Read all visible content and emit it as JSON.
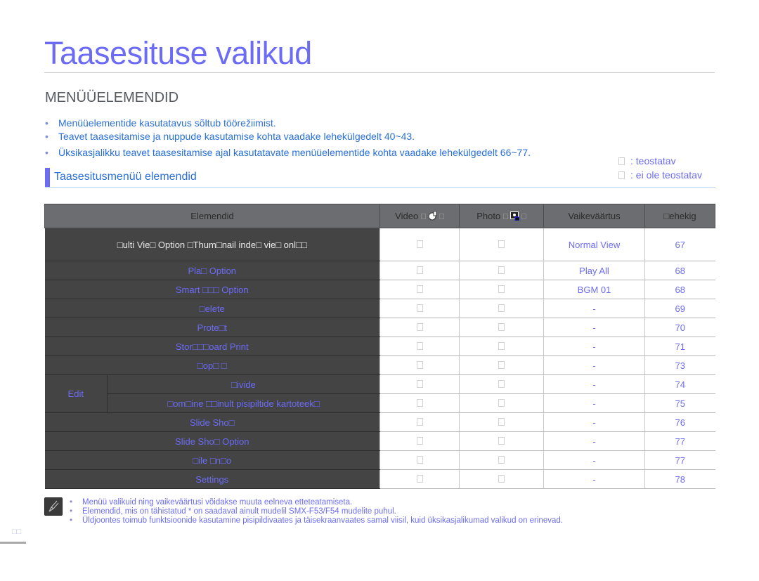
{
  "page": {
    "title": "Taasesituse valikud",
    "section_heading": "MENÜÜELEMENDID",
    "bullets": [
      "Menüüelementide kasutatavus sõltub töörežiimist.",
      "Teavet taasesitamise ja nuppude kasutamise kohta vaadake lehekülgedelt 40~43.",
      "Üksikasjalikku teavet taasesitamise ajal kasutatavate menüüelementide kohta vaadake lehekülgedelt 66~77."
    ],
    "legend": [
      {
        "icon": "available-box-icon",
        "label": ": teostatav"
      },
      {
        "icon": "unavailable-box-icon",
        "label": ": ei ole teostatav"
      }
    ],
    "subsection_heading": "Taasesitusmenüü elemendid",
    "page_number": "□□"
  },
  "table": {
    "headers": {
      "items": "Elemendid",
      "video": "Video",
      "photo": "Photo",
      "default": "Vaikeväärtus",
      "page": "□ehekig"
    },
    "rows": [
      {
        "item": "□ulti Vie□ Option □Thum□nail inde□ vie□ onl□□",
        "video": "□",
        "photo": "□",
        "default": "Normal View",
        "page": "67"
      },
      {
        "item": "Pla□ Option",
        "video": "□",
        "photo": "□",
        "default": "Play All",
        "page": "68"
      },
      {
        "item": "Smart □□□ Option",
        "video": "□",
        "photo": "□",
        "default": "BGM 01",
        "page": "68"
      },
      {
        "item": "□elete",
        "video": "□",
        "photo": "□",
        "default": "-",
        "page": "69"
      },
      {
        "item": "Prote□t",
        "video": "□",
        "photo": "□",
        "default": "-",
        "page": "70"
      },
      {
        "item": "Stor□□□oard Print",
        "video": "□",
        "photo": "□",
        "default": "-",
        "page": "71"
      },
      {
        "item": "□op□ □",
        "video": "□",
        "photo": "□",
        "default": "-",
        "page": "73"
      },
      {
        "group": "Edit",
        "item": "□ivide",
        "video": "□",
        "photo": "□",
        "default": "-",
        "page": "74"
      },
      {
        "item": "□om□ine □□inult pisipiltide kartoteek□",
        "video": "□",
        "photo": "□",
        "default": "-",
        "page": "75"
      },
      {
        "item": "Slide Sho□",
        "video": "□",
        "photo": "□",
        "default": "-",
        "page": "76"
      },
      {
        "item": "Slide Sho□ Option",
        "video": "□",
        "photo": "□",
        "default": "-",
        "page": "77"
      },
      {
        "item": "□ile □n□o",
        "video": "□",
        "photo": "□",
        "default": "-",
        "page": "77"
      },
      {
        "item": "Settings",
        "video": "□",
        "photo": "□",
        "default": "-",
        "page": "78"
      }
    ]
  },
  "notes": [
    "Menüü valikuid ning vaikeväärtusi võidakse muuta eelneva etteteatamiseta.",
    "Elemendid, mis on tähistatud * on saadaval ainult mudelil SMX-F53/F54 mudelite puhul.",
    "Üldjoontes toimub funktsioonide kasutamine pisipildivaates ja täisekraanvaates samal viisil, kuid üksikasjalikumad valikud on erinevad."
  ],
  "colors": {
    "accent": "#6b6bf5",
    "bullet_text": "#2a6fd6",
    "header_bg": "#6c6d70",
    "item_bg": "#444444"
  }
}
